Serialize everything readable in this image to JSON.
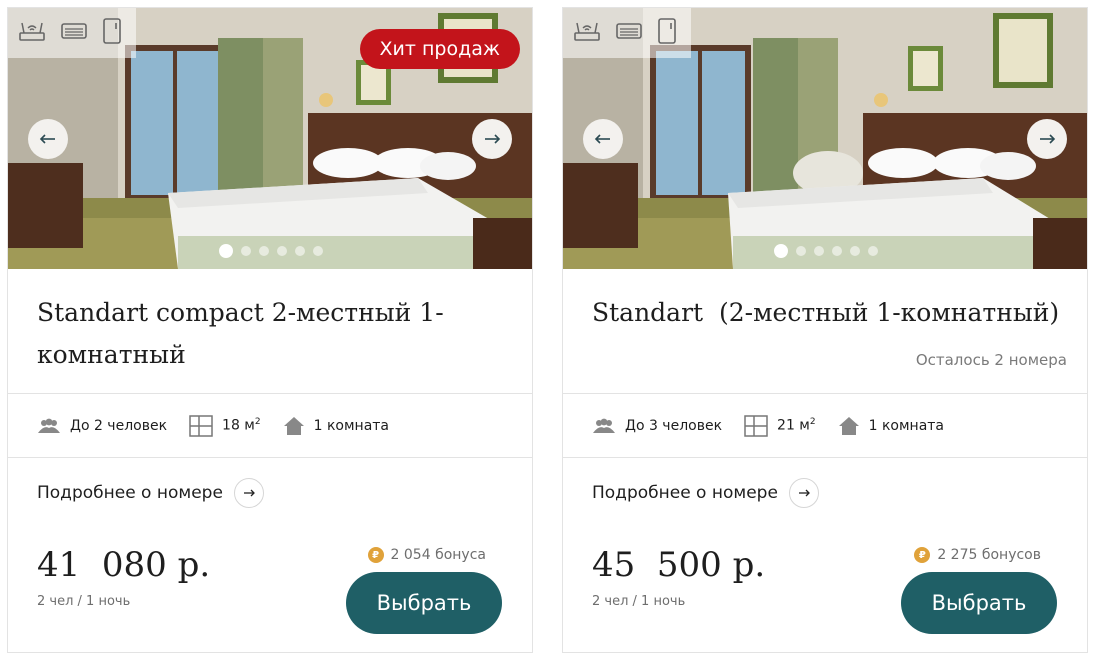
{
  "cards": [
    {
      "badge": "Хит продаж",
      "title": "Standart compact 2-местный 1-комнатный",
      "remaining": "",
      "features": {
        "guests": "До 2 человек",
        "area": "18 м",
        "area_sup": "2",
        "rooms": "1 комната"
      },
      "more_label": "Подробнее о номере",
      "price": "41  080 р.",
      "per": "2 чел / 1 ночь",
      "bonus": "2 054 бонуса",
      "select_label": "Выбрать",
      "gallery": {
        "slides": 6,
        "active": 1
      }
    },
    {
      "badge": "",
      "title": "Standart  (2-местный 1-комнатный)",
      "remaining": "Осталось 2 номера",
      "features": {
        "guests": "До 3 человек",
        "area": "21 м",
        "area_sup": "2",
        "rooms": "1 комната"
      },
      "more_label": "Подробнее о номере",
      "price": "45  500 р.",
      "per": "2 чел / 1 ночь",
      "bonus": "2 275 бонусов",
      "select_label": "Выбрать",
      "gallery": {
        "slides": 6,
        "active": 1
      }
    }
  ],
  "amenity_icons": [
    "wifi-router-icon",
    "air-conditioner-icon",
    "refrigerator-icon"
  ],
  "colors": {
    "accent": "#1f5f66",
    "badge": "#c3141b",
    "bonus_coin": "#e0a23a"
  }
}
